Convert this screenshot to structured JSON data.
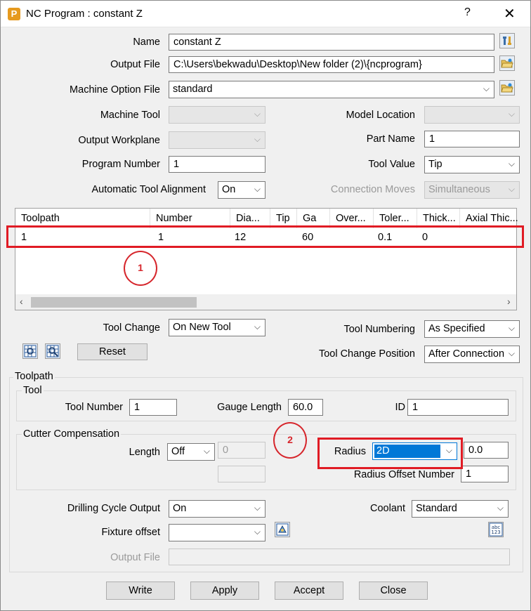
{
  "window": {
    "title": "NC Program : constant Z",
    "help": "?",
    "close": "✕"
  },
  "fields": {
    "name_label": "Name",
    "name_value": "constant Z",
    "output_file_label": "Output File",
    "output_file_value": "C:\\Users\\bekwadu\\Desktop\\New folder (2)\\{ncprogram}",
    "machine_option_label": "Machine Option File",
    "machine_option_value": "standard",
    "machine_tool_label": "Machine Tool",
    "machine_tool_value": "",
    "model_location_label": "Model Location",
    "model_location_value": "",
    "output_workplane_label": "Output Workplane",
    "output_workplane_value": "",
    "part_name_label": "Part Name",
    "part_name_value": "1",
    "program_number_label": "Program Number",
    "program_number_value": "1",
    "tool_value_label": "Tool Value",
    "tool_value_value": "Tip",
    "auto_align_label": "Automatic Tool Alignment",
    "auto_align_value": "On",
    "connection_moves_label": "Connection Moves",
    "connection_moves_value": "Simultaneous"
  },
  "table": {
    "columns": [
      "Toolpath",
      "Number",
      "Dia...",
      "Tip",
      "Ga",
      "Over...",
      "Toler...",
      "Thick...",
      "Axial Thic..."
    ],
    "row": [
      "1",
      "1",
      "12",
      "",
      "60",
      "",
      "0.1",
      "0",
      ""
    ]
  },
  "tool_change": {
    "tool_change_label": "Tool Change",
    "tool_change_value": "On New Tool",
    "tool_numbering_label": "Tool Numbering",
    "tool_numbering_value": "As Specified",
    "reset_label": "Reset",
    "tool_change_position_label": "Tool Change Position",
    "tool_change_position_value": "After Connection"
  },
  "toolpath_group": {
    "title": "Toolpath",
    "tool_title": "Tool",
    "tool_number_label": "Tool Number",
    "tool_number_value": "1",
    "gauge_length_label": "Gauge Length",
    "gauge_length_value": "60.0",
    "id_label": "ID",
    "id_value": "1",
    "cutter_title": "Cutter Compensation",
    "length_label": "Length",
    "length_value": "Off",
    "length_offset_value": "0",
    "radius_label": "Radius",
    "radius_value": "2D",
    "radius_offset_value": "0.0",
    "radius_offset_number_label": "Radius Offset Number",
    "radius_offset_number_value": "1"
  },
  "bottom": {
    "drilling_label": "Drilling Cycle Output",
    "drilling_value": "On",
    "coolant_label": "Coolant",
    "coolant_value": "Standard",
    "fixture_label": "Fixture offset",
    "fixture_value": "",
    "output_file_label": "Output File",
    "output_file_value": "",
    "abc_icon_text": "abc\n123"
  },
  "buttons": {
    "write": "Write",
    "apply": "Apply",
    "accept": "Accept",
    "close": "Close"
  },
  "annotations": {
    "marker1": "1",
    "marker2": "2",
    "color": "#e01b24"
  },
  "chevron": "⌵"
}
